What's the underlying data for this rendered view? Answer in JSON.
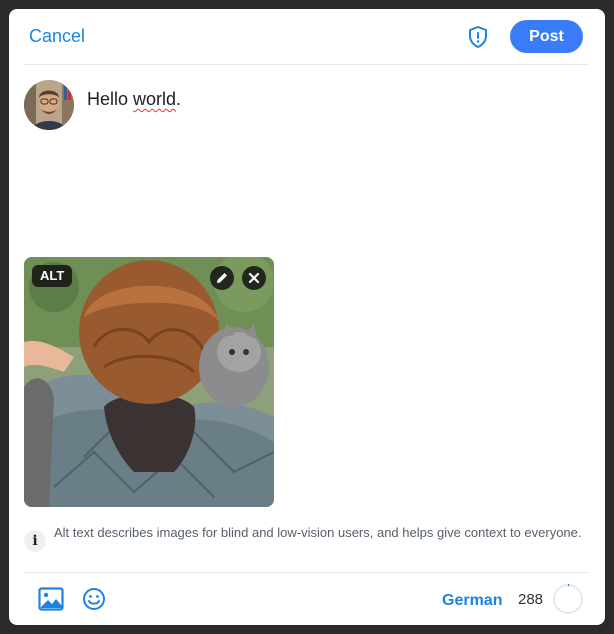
{
  "header": {
    "cancel_label": "Cancel",
    "shield_icon": "shield-alert-icon",
    "post_label": "Post"
  },
  "composer": {
    "text_before": "Hello ",
    "text_misspelled": "world",
    "text_after": ".",
    "avatar_icon": "avatar"
  },
  "media": {
    "alt_label": "ALT",
    "edit_icon": "pencil-icon",
    "remove_icon": "close-icon"
  },
  "info": {
    "icon_glyph": "i",
    "text": "Alt text describes images for blind and low-vision users, and helps give context to everyone."
  },
  "footer": {
    "image_icon": "image-icon",
    "emoji_icon": "emoji-icon",
    "language": "German",
    "char_count": "288",
    "char_progress": 0.0
  },
  "colors": {
    "accent": "#1d83e2",
    "post_button": "#3a7cf7"
  }
}
